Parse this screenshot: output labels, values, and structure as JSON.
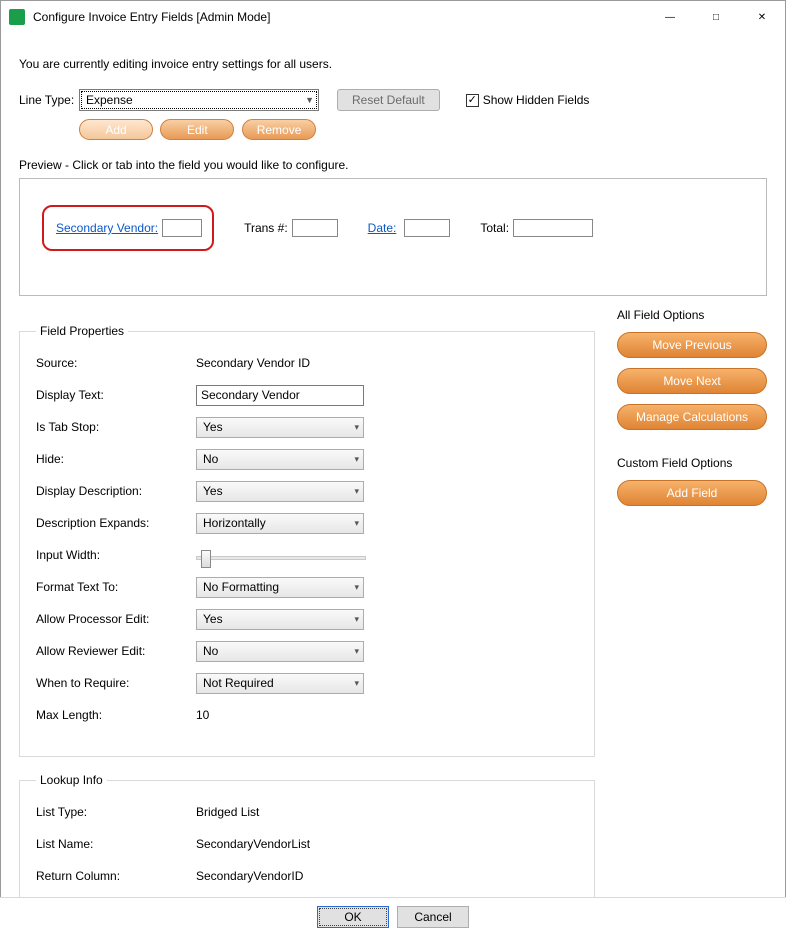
{
  "title": "Configure Invoice Entry Fields [Admin Mode]",
  "window_controls": {
    "min": "—",
    "max": "□",
    "close": "✕"
  },
  "intro": "You are currently editing invoice entry settings for all users.",
  "linetype": {
    "label": "Line Type:",
    "value": "Expense"
  },
  "reset_default": "Reset Default",
  "show_hidden": {
    "label": "Show Hidden Fields",
    "checked": "✓"
  },
  "buttons": {
    "add": "Add",
    "edit": "Edit",
    "remove": "Remove"
  },
  "preview_label": "Preview - Click or tab into the field you would like to configure.",
  "preview": {
    "selected_label": "Secondary Vendor:",
    "trans_label": "Trans #:",
    "date_label": "Date:",
    "total_label": "Total:"
  },
  "field_properties": {
    "legend": "Field Properties",
    "source_label": "Source:",
    "source_value": "Secondary Vendor ID",
    "display_text_label": "Display Text:",
    "display_text_value": "Secondary Vendor",
    "is_tab_stop_label": "Is Tab Stop:",
    "is_tab_stop_value": "Yes",
    "hide_label": "Hide:",
    "hide_value": "No",
    "display_desc_label": "Display Description:",
    "display_desc_value": "Yes",
    "desc_expands_label": "Description Expands:",
    "desc_expands_value": "Horizontally",
    "input_width_label": "Input Width:",
    "format_label": "Format Text To:",
    "format_value": "No Formatting",
    "allow_proc_label": "Allow Processor Edit:",
    "allow_proc_value": "Yes",
    "allow_rev_label": "Allow Reviewer Edit:",
    "allow_rev_value": "No",
    "when_req_label": "When to Require:",
    "when_req_value": "Not Required",
    "max_length_label": "Max Length:",
    "max_length_value": "10"
  },
  "all_field_options": {
    "heading": "All Field Options",
    "move_previous": "Move Previous",
    "move_next": "Move Next",
    "manage_calculations": "Manage Calculations"
  },
  "custom_field_options": {
    "heading": "Custom Field Options",
    "add_field": "Add Field"
  },
  "lookup_info": {
    "legend": "Lookup Info",
    "list_type_label": "List Type:",
    "list_type_value": "Bridged List",
    "list_name_label": "List Name:",
    "list_name_value": "SecondaryVendorList",
    "return_col_label": "Return Column:",
    "return_col_value": "SecondaryVendorID"
  },
  "footer": {
    "ok": "OK",
    "cancel": "Cancel"
  }
}
